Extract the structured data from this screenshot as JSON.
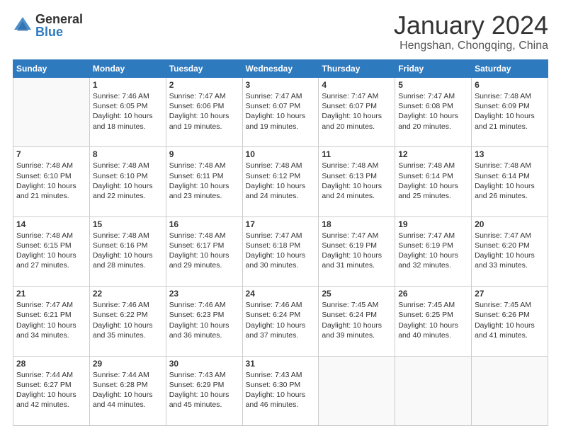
{
  "header": {
    "logo_general": "General",
    "logo_blue": "Blue",
    "month_title": "January 2024",
    "location": "Hengshan, Chongqing, China"
  },
  "days_of_week": [
    "Sunday",
    "Monday",
    "Tuesday",
    "Wednesday",
    "Thursday",
    "Friday",
    "Saturday"
  ],
  "weeks": [
    [
      {
        "day": "",
        "info": ""
      },
      {
        "day": "1",
        "info": "Sunrise: 7:46 AM\nSunset: 6:05 PM\nDaylight: 10 hours\nand 18 minutes."
      },
      {
        "day": "2",
        "info": "Sunrise: 7:47 AM\nSunset: 6:06 PM\nDaylight: 10 hours\nand 19 minutes."
      },
      {
        "day": "3",
        "info": "Sunrise: 7:47 AM\nSunset: 6:07 PM\nDaylight: 10 hours\nand 19 minutes."
      },
      {
        "day": "4",
        "info": "Sunrise: 7:47 AM\nSunset: 6:07 PM\nDaylight: 10 hours\nand 20 minutes."
      },
      {
        "day": "5",
        "info": "Sunrise: 7:47 AM\nSunset: 6:08 PM\nDaylight: 10 hours\nand 20 minutes."
      },
      {
        "day": "6",
        "info": "Sunrise: 7:48 AM\nSunset: 6:09 PM\nDaylight: 10 hours\nand 21 minutes."
      }
    ],
    [
      {
        "day": "7",
        "info": "Sunrise: 7:48 AM\nSunset: 6:10 PM\nDaylight: 10 hours\nand 21 minutes."
      },
      {
        "day": "8",
        "info": "Sunrise: 7:48 AM\nSunset: 6:10 PM\nDaylight: 10 hours\nand 22 minutes."
      },
      {
        "day": "9",
        "info": "Sunrise: 7:48 AM\nSunset: 6:11 PM\nDaylight: 10 hours\nand 23 minutes."
      },
      {
        "day": "10",
        "info": "Sunrise: 7:48 AM\nSunset: 6:12 PM\nDaylight: 10 hours\nand 24 minutes."
      },
      {
        "day": "11",
        "info": "Sunrise: 7:48 AM\nSunset: 6:13 PM\nDaylight: 10 hours\nand 24 minutes."
      },
      {
        "day": "12",
        "info": "Sunrise: 7:48 AM\nSunset: 6:14 PM\nDaylight: 10 hours\nand 25 minutes."
      },
      {
        "day": "13",
        "info": "Sunrise: 7:48 AM\nSunset: 6:14 PM\nDaylight: 10 hours\nand 26 minutes."
      }
    ],
    [
      {
        "day": "14",
        "info": "Sunrise: 7:48 AM\nSunset: 6:15 PM\nDaylight: 10 hours\nand 27 minutes."
      },
      {
        "day": "15",
        "info": "Sunrise: 7:48 AM\nSunset: 6:16 PM\nDaylight: 10 hours\nand 28 minutes."
      },
      {
        "day": "16",
        "info": "Sunrise: 7:48 AM\nSunset: 6:17 PM\nDaylight: 10 hours\nand 29 minutes."
      },
      {
        "day": "17",
        "info": "Sunrise: 7:47 AM\nSunset: 6:18 PM\nDaylight: 10 hours\nand 30 minutes."
      },
      {
        "day": "18",
        "info": "Sunrise: 7:47 AM\nSunset: 6:19 PM\nDaylight: 10 hours\nand 31 minutes."
      },
      {
        "day": "19",
        "info": "Sunrise: 7:47 AM\nSunset: 6:19 PM\nDaylight: 10 hours\nand 32 minutes."
      },
      {
        "day": "20",
        "info": "Sunrise: 7:47 AM\nSunset: 6:20 PM\nDaylight: 10 hours\nand 33 minutes."
      }
    ],
    [
      {
        "day": "21",
        "info": "Sunrise: 7:47 AM\nSunset: 6:21 PM\nDaylight: 10 hours\nand 34 minutes."
      },
      {
        "day": "22",
        "info": "Sunrise: 7:46 AM\nSunset: 6:22 PM\nDaylight: 10 hours\nand 35 minutes."
      },
      {
        "day": "23",
        "info": "Sunrise: 7:46 AM\nSunset: 6:23 PM\nDaylight: 10 hours\nand 36 minutes."
      },
      {
        "day": "24",
        "info": "Sunrise: 7:46 AM\nSunset: 6:24 PM\nDaylight: 10 hours\nand 37 minutes."
      },
      {
        "day": "25",
        "info": "Sunrise: 7:45 AM\nSunset: 6:24 PM\nDaylight: 10 hours\nand 39 minutes."
      },
      {
        "day": "26",
        "info": "Sunrise: 7:45 AM\nSunset: 6:25 PM\nDaylight: 10 hours\nand 40 minutes."
      },
      {
        "day": "27",
        "info": "Sunrise: 7:45 AM\nSunset: 6:26 PM\nDaylight: 10 hours\nand 41 minutes."
      }
    ],
    [
      {
        "day": "28",
        "info": "Sunrise: 7:44 AM\nSunset: 6:27 PM\nDaylight: 10 hours\nand 42 minutes."
      },
      {
        "day": "29",
        "info": "Sunrise: 7:44 AM\nSunset: 6:28 PM\nDaylight: 10 hours\nand 44 minutes."
      },
      {
        "day": "30",
        "info": "Sunrise: 7:43 AM\nSunset: 6:29 PM\nDaylight: 10 hours\nand 45 minutes."
      },
      {
        "day": "31",
        "info": "Sunrise: 7:43 AM\nSunset: 6:30 PM\nDaylight: 10 hours\nand 46 minutes."
      },
      {
        "day": "",
        "info": ""
      },
      {
        "day": "",
        "info": ""
      },
      {
        "day": "",
        "info": ""
      }
    ]
  ]
}
